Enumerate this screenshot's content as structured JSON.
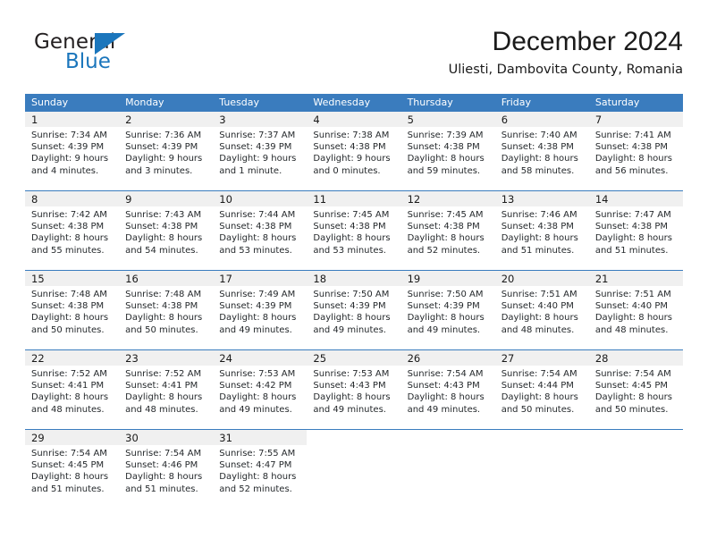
{
  "brand": {
    "name_part1": "General",
    "name_part2": "Blue",
    "accent_color": "#1b76bc"
  },
  "header": {
    "title": "December 2024",
    "subtitle": "Uliesti, Dambovita County, Romania"
  },
  "calendar": {
    "header_bg": "#3a7cbe",
    "daynum_bg": "#f0f0f0",
    "weekday_headers": [
      "Sunday",
      "Monday",
      "Tuesday",
      "Wednesday",
      "Thursday",
      "Friday",
      "Saturday"
    ],
    "weeks": [
      [
        {
          "day": "1",
          "sunrise": "Sunrise: 7:34 AM",
          "sunset": "Sunset: 4:39 PM",
          "daylight_line1": "Daylight: 9 hours",
          "daylight_line2": "and 4 minutes."
        },
        {
          "day": "2",
          "sunrise": "Sunrise: 7:36 AM",
          "sunset": "Sunset: 4:39 PM",
          "daylight_line1": "Daylight: 9 hours",
          "daylight_line2": "and 3 minutes."
        },
        {
          "day": "3",
          "sunrise": "Sunrise: 7:37 AM",
          "sunset": "Sunset: 4:39 PM",
          "daylight_line1": "Daylight: 9 hours",
          "daylight_line2": "and 1 minute."
        },
        {
          "day": "4",
          "sunrise": "Sunrise: 7:38 AM",
          "sunset": "Sunset: 4:38 PM",
          "daylight_line1": "Daylight: 9 hours",
          "daylight_line2": "and 0 minutes."
        },
        {
          "day": "5",
          "sunrise": "Sunrise: 7:39 AM",
          "sunset": "Sunset: 4:38 PM",
          "daylight_line1": "Daylight: 8 hours",
          "daylight_line2": "and 59 minutes."
        },
        {
          "day": "6",
          "sunrise": "Sunrise: 7:40 AM",
          "sunset": "Sunset: 4:38 PM",
          "daylight_line1": "Daylight: 8 hours",
          "daylight_line2": "and 58 minutes."
        },
        {
          "day": "7",
          "sunrise": "Sunrise: 7:41 AM",
          "sunset": "Sunset: 4:38 PM",
          "daylight_line1": "Daylight: 8 hours",
          "daylight_line2": "and 56 minutes."
        }
      ],
      [
        {
          "day": "8",
          "sunrise": "Sunrise: 7:42 AM",
          "sunset": "Sunset: 4:38 PM",
          "daylight_line1": "Daylight: 8 hours",
          "daylight_line2": "and 55 minutes."
        },
        {
          "day": "9",
          "sunrise": "Sunrise: 7:43 AM",
          "sunset": "Sunset: 4:38 PM",
          "daylight_line1": "Daylight: 8 hours",
          "daylight_line2": "and 54 minutes."
        },
        {
          "day": "10",
          "sunrise": "Sunrise: 7:44 AM",
          "sunset": "Sunset: 4:38 PM",
          "daylight_line1": "Daylight: 8 hours",
          "daylight_line2": "and 53 minutes."
        },
        {
          "day": "11",
          "sunrise": "Sunrise: 7:45 AM",
          "sunset": "Sunset: 4:38 PM",
          "daylight_line1": "Daylight: 8 hours",
          "daylight_line2": "and 53 minutes."
        },
        {
          "day": "12",
          "sunrise": "Sunrise: 7:45 AM",
          "sunset": "Sunset: 4:38 PM",
          "daylight_line1": "Daylight: 8 hours",
          "daylight_line2": "and 52 minutes."
        },
        {
          "day": "13",
          "sunrise": "Sunrise: 7:46 AM",
          "sunset": "Sunset: 4:38 PM",
          "daylight_line1": "Daylight: 8 hours",
          "daylight_line2": "and 51 minutes."
        },
        {
          "day": "14",
          "sunrise": "Sunrise: 7:47 AM",
          "sunset": "Sunset: 4:38 PM",
          "daylight_line1": "Daylight: 8 hours",
          "daylight_line2": "and 51 minutes."
        }
      ],
      [
        {
          "day": "15",
          "sunrise": "Sunrise: 7:48 AM",
          "sunset": "Sunset: 4:38 PM",
          "daylight_line1": "Daylight: 8 hours",
          "daylight_line2": "and 50 minutes."
        },
        {
          "day": "16",
          "sunrise": "Sunrise: 7:48 AM",
          "sunset": "Sunset: 4:38 PM",
          "daylight_line1": "Daylight: 8 hours",
          "daylight_line2": "and 50 minutes."
        },
        {
          "day": "17",
          "sunrise": "Sunrise: 7:49 AM",
          "sunset": "Sunset: 4:39 PM",
          "daylight_line1": "Daylight: 8 hours",
          "daylight_line2": "and 49 minutes."
        },
        {
          "day": "18",
          "sunrise": "Sunrise: 7:50 AM",
          "sunset": "Sunset: 4:39 PM",
          "daylight_line1": "Daylight: 8 hours",
          "daylight_line2": "and 49 minutes."
        },
        {
          "day": "19",
          "sunrise": "Sunrise: 7:50 AM",
          "sunset": "Sunset: 4:39 PM",
          "daylight_line1": "Daylight: 8 hours",
          "daylight_line2": "and 49 minutes."
        },
        {
          "day": "20",
          "sunrise": "Sunrise: 7:51 AM",
          "sunset": "Sunset: 4:40 PM",
          "daylight_line1": "Daylight: 8 hours",
          "daylight_line2": "and 48 minutes."
        },
        {
          "day": "21",
          "sunrise": "Sunrise: 7:51 AM",
          "sunset": "Sunset: 4:40 PM",
          "daylight_line1": "Daylight: 8 hours",
          "daylight_line2": "and 48 minutes."
        }
      ],
      [
        {
          "day": "22",
          "sunrise": "Sunrise: 7:52 AM",
          "sunset": "Sunset: 4:41 PM",
          "daylight_line1": "Daylight: 8 hours",
          "daylight_line2": "and 48 minutes."
        },
        {
          "day": "23",
          "sunrise": "Sunrise: 7:52 AM",
          "sunset": "Sunset: 4:41 PM",
          "daylight_line1": "Daylight: 8 hours",
          "daylight_line2": "and 48 minutes."
        },
        {
          "day": "24",
          "sunrise": "Sunrise: 7:53 AM",
          "sunset": "Sunset: 4:42 PM",
          "daylight_line1": "Daylight: 8 hours",
          "daylight_line2": "and 49 minutes."
        },
        {
          "day": "25",
          "sunrise": "Sunrise: 7:53 AM",
          "sunset": "Sunset: 4:43 PM",
          "daylight_line1": "Daylight: 8 hours",
          "daylight_line2": "and 49 minutes."
        },
        {
          "day": "26",
          "sunrise": "Sunrise: 7:54 AM",
          "sunset": "Sunset: 4:43 PM",
          "daylight_line1": "Daylight: 8 hours",
          "daylight_line2": "and 49 minutes."
        },
        {
          "day": "27",
          "sunrise": "Sunrise: 7:54 AM",
          "sunset": "Sunset: 4:44 PM",
          "daylight_line1": "Daylight: 8 hours",
          "daylight_line2": "and 50 minutes."
        },
        {
          "day": "28",
          "sunrise": "Sunrise: 7:54 AM",
          "sunset": "Sunset: 4:45 PM",
          "daylight_line1": "Daylight: 8 hours",
          "daylight_line2": "and 50 minutes."
        }
      ],
      [
        {
          "day": "29",
          "sunrise": "Sunrise: 7:54 AM",
          "sunset": "Sunset: 4:45 PM",
          "daylight_line1": "Daylight: 8 hours",
          "daylight_line2": "and 51 minutes."
        },
        {
          "day": "30",
          "sunrise": "Sunrise: 7:54 AM",
          "sunset": "Sunset: 4:46 PM",
          "daylight_line1": "Daylight: 8 hours",
          "daylight_line2": "and 51 minutes."
        },
        {
          "day": "31",
          "sunrise": "Sunrise: 7:55 AM",
          "sunset": "Sunset: 4:47 PM",
          "daylight_line1": "Daylight: 8 hours",
          "daylight_line2": "and 52 minutes."
        },
        {
          "day": "",
          "sunrise": "",
          "sunset": "",
          "daylight_line1": "",
          "daylight_line2": ""
        },
        {
          "day": "",
          "sunrise": "",
          "sunset": "",
          "daylight_line1": "",
          "daylight_line2": ""
        },
        {
          "day": "",
          "sunrise": "",
          "sunset": "",
          "daylight_line1": "",
          "daylight_line2": ""
        },
        {
          "day": "",
          "sunrise": "",
          "sunset": "",
          "daylight_line1": "",
          "daylight_line2": ""
        }
      ]
    ]
  }
}
